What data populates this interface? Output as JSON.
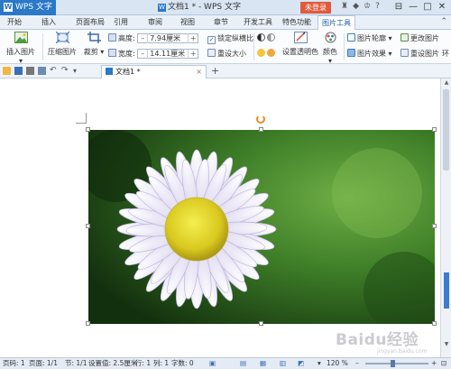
{
  "titlebar": {
    "app_name": "WPS 文字",
    "doc_title": "文档1 * - WPS 文字",
    "login": "未登录",
    "icons": [
      "shirt-icon",
      "gem-icon",
      "clothes-icon",
      "help-icon"
    ],
    "window_controls": [
      "⊟",
      "—",
      "□",
      "✕"
    ]
  },
  "menubar": {
    "tabs": [
      "开始",
      "插入",
      "页面布局",
      "引用",
      "审阅",
      "视图",
      "章节",
      "开发工具",
      "特色功能",
      "图片工具"
    ],
    "active_tab": "图片工具"
  },
  "ribbon": {
    "insert_picture": "插入图片",
    "compress_picture": "压缩图片",
    "crop": "裁剪",
    "height_label": "高度:",
    "height_value": "7.94厘米",
    "width_label": "宽度:",
    "width_value": "14.11厘米",
    "lock_ratio": "锁定纵横比",
    "reset_size": "重设大小",
    "set_transparent": "设置透明色",
    "color": "颜色",
    "picture_outline": "图片轮廓",
    "picture_effect": "图片效果",
    "change_picture": "更改图片",
    "reset_picture": "重设图片",
    "more": "环"
  },
  "doctab": {
    "name": "文档1 *"
  },
  "status": {
    "page": "页码: 1",
    "pages": "页面: 1/1",
    "section": "节: 1/1",
    "setting": "设置值: 2.5厘米",
    "row": "行: 1",
    "col": "列: 1",
    "words": "字数: 0",
    "zoom": "120 %"
  },
  "watermark": {
    "main": "Baidu经验",
    "sub": "jingyan.baidu.com"
  },
  "colors": {
    "accent": "#2a78c8",
    "login": "#e05b3b",
    "ribbon_bg": "#fbfcfe"
  }
}
